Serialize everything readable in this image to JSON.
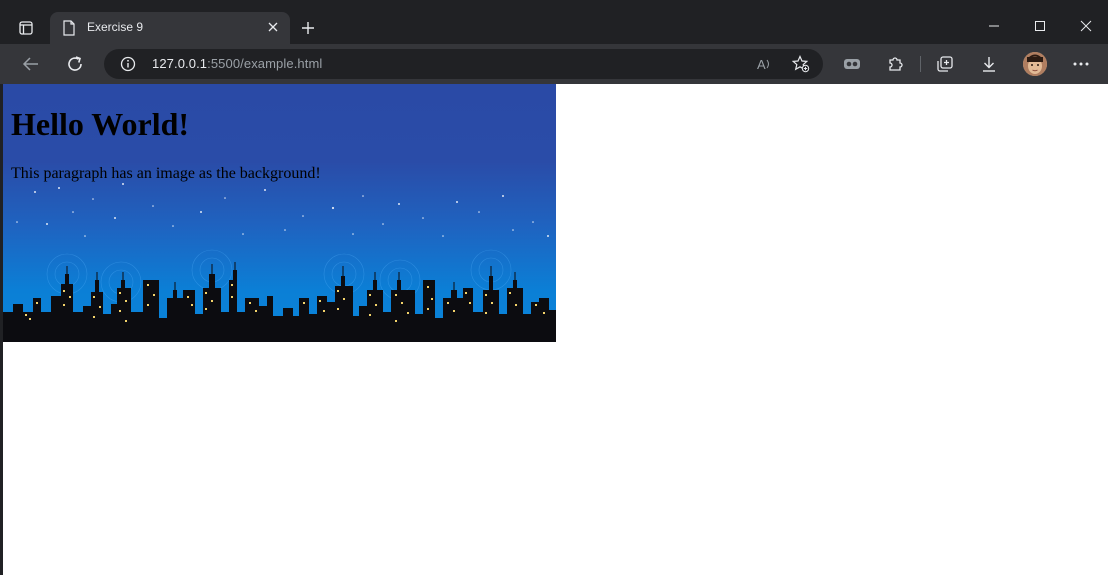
{
  "browser": {
    "tab": {
      "title": "Exercise 9"
    },
    "omnibox": {
      "host": "127.0.0.1",
      "path": ":5500/example.html"
    },
    "icons": {
      "tab_actions": "tab-actions-icon",
      "favicon": "page-icon",
      "tab_close": "close-icon",
      "new_tab": "plus-icon",
      "minimize": "minimize-icon",
      "maximize": "maximize-icon",
      "close_window": "close-icon",
      "back": "arrow-left-icon",
      "refresh": "refresh-icon",
      "site_info": "info-icon",
      "read_aloud": "read-aloud-icon",
      "favorites": "star-add-icon",
      "extension_badge": "glasses-icon",
      "extensions": "puzzle-icon",
      "collections": "collections-icon",
      "downloads": "download-icon",
      "profile": "avatar",
      "more": "more-icon"
    },
    "colors": {
      "frame": "#202124",
      "toolbar": "#35363a",
      "text": "#e8eaed"
    }
  },
  "page": {
    "heading": "Hello World!",
    "paragraph": "This paragraph has an image as the background!",
    "background_image": "night city skyline"
  }
}
